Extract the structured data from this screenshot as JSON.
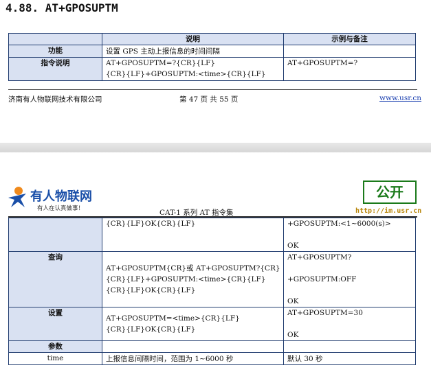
{
  "section": {
    "title": "4.88. AT+GPOSUPTM"
  },
  "table1": {
    "headers": [
      "",
      "说明",
      "示例与备注"
    ],
    "rows": [
      {
        "label": "功能",
        "desc": [
          "设置 GPS 主动上报信息的时间间隔"
        ],
        "example": [
          ""
        ]
      },
      {
        "label": "指令说明",
        "desc": [
          "AT+GPOSUPTM=?{CR}{LF}",
          "{CR}{LF}+GPOSUPTM:<time>{CR}{LF}"
        ],
        "example": [
          "AT+GPOSUPTM=?"
        ]
      }
    ]
  },
  "footer": {
    "company": "济南有人物联网技术有限公司",
    "page": "第 47 页 共 55 页",
    "url": "www.usr.cn"
  },
  "page2_header": {
    "logo_name": "有人物联网",
    "logo_slogan": "有人在认真做事！",
    "doc_title": "CAT-1 系列 AT 指令集",
    "stamp_text": "公开",
    "stamp_url": "http://im.usr.cn"
  },
  "table2": {
    "rows": [
      {
        "label": "",
        "desc": [
          "{CR}{LF}OK{CR}{LF}"
        ],
        "example": [
          "+GPOSUPTM:<1~6000(s)>",
          "",
          "OK"
        ]
      },
      {
        "label": "查询",
        "desc": [
          "AT+GPOSUPTM{CR}或 AT+GPOSUPTM?{CR}",
          "{CR}{LF}+GPOSUPTM:<time>{CR}{LF}",
          "{CR}{LF}OK{CR}{LF}"
        ],
        "example": [
          "AT+GPOSUPTM?",
          "",
          "+GPOSUPTM:OFF",
          "",
          "OK"
        ]
      },
      {
        "label": "设置",
        "desc": [
          "AT+GPOSUPTM=<time>{CR}{LF}",
          "{CR}{LF}OK{CR}{LF}"
        ],
        "example": [
          "AT+GPOSUPTM=30",
          "",
          "OK"
        ]
      },
      {
        "label": "参数",
        "desc": [
          ""
        ],
        "example": [
          ""
        ]
      },
      {
        "label": "time",
        "desc": [
          "上报信息间隔时间，范围为 1~6000 秒"
        ],
        "example": [
          "默认 30 秒"
        ]
      }
    ]
  }
}
